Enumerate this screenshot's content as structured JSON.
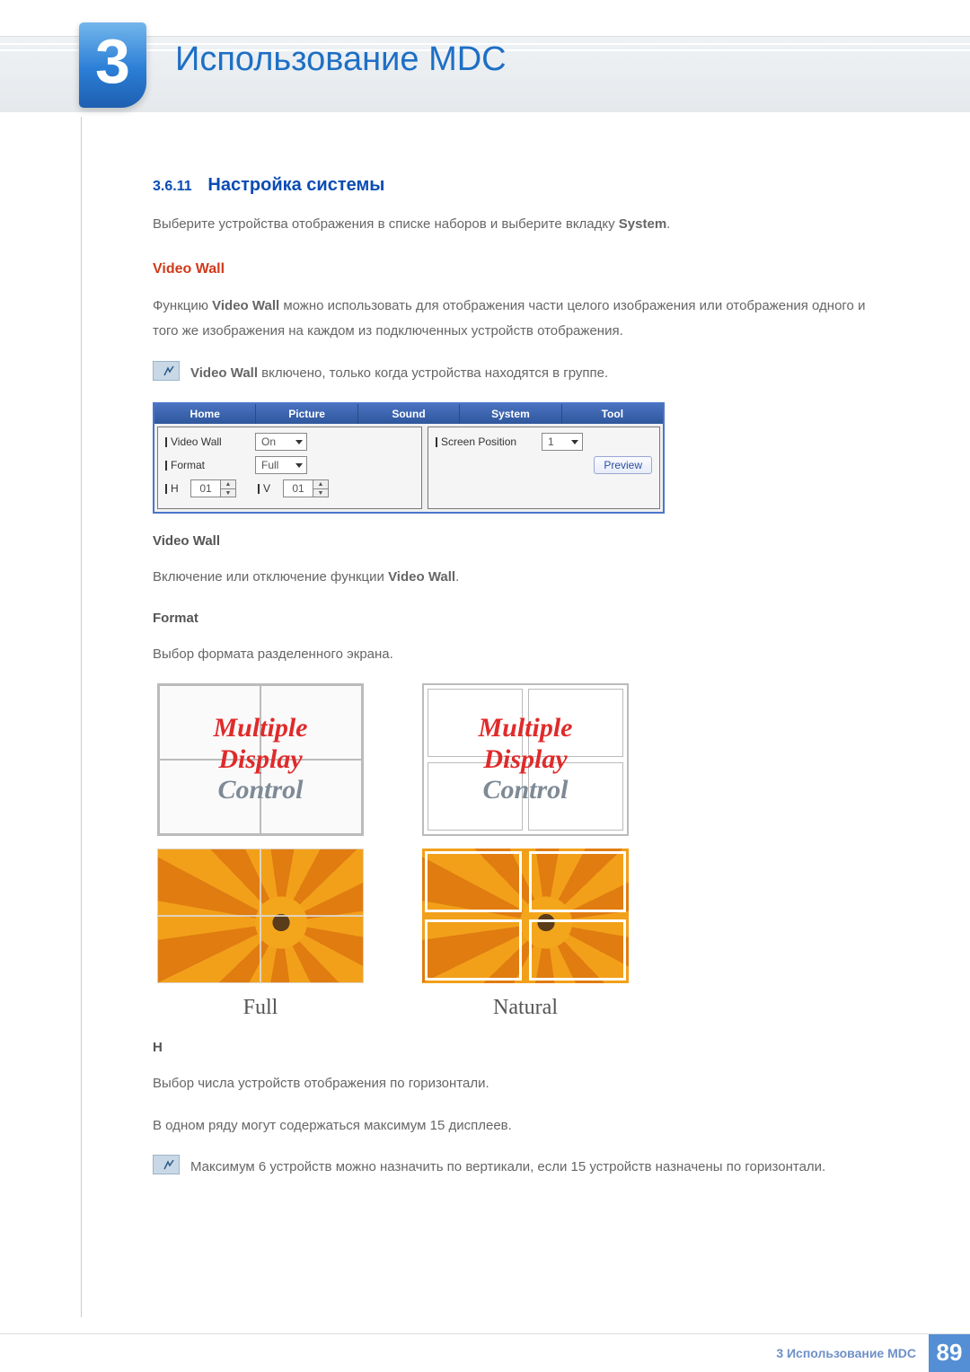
{
  "chapter": {
    "number": "3",
    "title": "Использование MDC"
  },
  "section": {
    "number": "3.6.11",
    "title": "Настройка системы"
  },
  "intro": {
    "p1_a": "Выберите устройства отображения в списке наборов и выберите вкладку ",
    "p1_b": "System",
    "p1_c": "."
  },
  "videoWall": {
    "heading": "Video Wall",
    "desc_a": "Функцию ",
    "desc_b": "Video Wall",
    "desc_c": " можно использовать для отображения части целого изображения или отображения одного и того же изображения на каждом из подключенных устройств отображения.",
    "note_a": "Video Wall",
    "note_b": " включено, только когда устройства находятся в группе."
  },
  "panel": {
    "tabs": [
      "Home",
      "Picture",
      "Sound",
      "System",
      "Tool"
    ],
    "videoWallLabel": "Video Wall",
    "videoWallValue": "On",
    "formatLabel": "Format",
    "formatValue": "Full",
    "hLabel": "H",
    "hValue": "01",
    "vLabel": "V",
    "vValue": "01",
    "screenPosLabel": "Screen Position",
    "screenPosValue": "1",
    "previewLabel": "Preview"
  },
  "subVideoWall": {
    "title": "Video Wall",
    "desc_a": "Включение или отключение функции ",
    "desc_b": "Video Wall",
    "desc_c": "."
  },
  "format": {
    "title": "Format",
    "desc": "Выбор формата разделенного экрана."
  },
  "figures": {
    "overlay1": "Multiple",
    "overlay2": "Display",
    "overlay3": "Control",
    "captionFull": "Full",
    "captionNatural": "Natural"
  },
  "h": {
    "title": "H",
    "desc": "Выбор числа устройств отображения по горизонтали.",
    "desc2": "В одном ряду могут содержаться максимум 15 дисплеев.",
    "note": "Максимум 6 устройств можно назначить по вертикали, если 15 устройств назначены по горизонтали."
  },
  "footer": {
    "text": "3 Использование MDC",
    "page": "89"
  }
}
